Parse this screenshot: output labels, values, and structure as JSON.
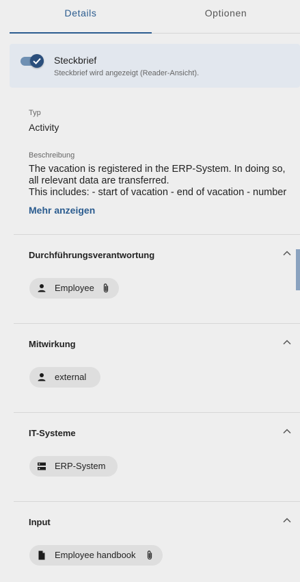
{
  "tabs": {
    "details": "Details",
    "optionen": "Optionen"
  },
  "steckbrief": {
    "title": "Steckbrief",
    "subtitle": "Steckbrief wird angezeigt (Reader-Ansicht).",
    "enabled": true
  },
  "typ": {
    "label": "Typ",
    "value": "Activity"
  },
  "beschreibung": {
    "label": "Beschreibung",
    "text": "The vacation is registered in the ERP-System. In doing so, all relevant data are transferred.\nThis includes: - start of vacation - end of vacation - number of days",
    "more_label": "Mehr anzeigen"
  },
  "sections": {
    "durchfuehrung": {
      "title": "Durchführungsverantwortung",
      "chip": "Employee",
      "chip_icon": "person-icon",
      "has_attachment": true
    },
    "mitwirkung": {
      "title": "Mitwirkung",
      "chip": "external",
      "chip_icon": "person-icon",
      "has_attachment": false
    },
    "it_systeme": {
      "title": "IT-Systeme",
      "chip": "ERP-System",
      "chip_icon": "server-icon",
      "has_attachment": false
    },
    "input": {
      "title": "Input",
      "chip": "Employee handbook",
      "chip_icon": "document-icon",
      "has_attachment": true
    }
  },
  "colors": {
    "accent": "#2b5c8f",
    "background": "#eeeeee",
    "chip": "#dedede",
    "toggle_track": "#6f90b3",
    "toggle_thumb": "#2b4f7c"
  }
}
